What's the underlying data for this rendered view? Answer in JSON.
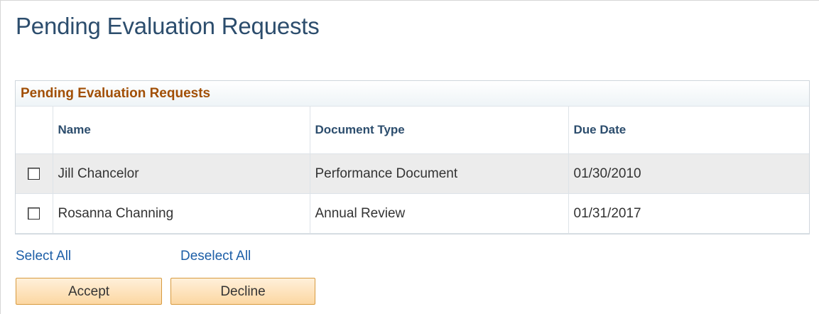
{
  "page": {
    "title": "Pending Evaluation Requests"
  },
  "grid": {
    "title": "Pending Evaluation Requests",
    "columns": [
      "Name",
      "Document Type",
      "Due Date"
    ],
    "rows": [
      {
        "name": "Jill Chancelor",
        "document_type": "Performance Document",
        "due_date": "01/30/2010",
        "checked": false
      },
      {
        "name": "Rosanna Channing",
        "document_type": "Annual Review",
        "due_date": "01/31/2017",
        "checked": false
      }
    ]
  },
  "links": {
    "select_all": "Select All",
    "deselect_all": "Deselect All"
  },
  "buttons": {
    "accept": "Accept",
    "decline": "Decline"
  },
  "colors": {
    "title": "#2c4d6d",
    "grid_header": "#a14f05",
    "link": "#1c5ea7",
    "button_border": "#d79a3f"
  }
}
